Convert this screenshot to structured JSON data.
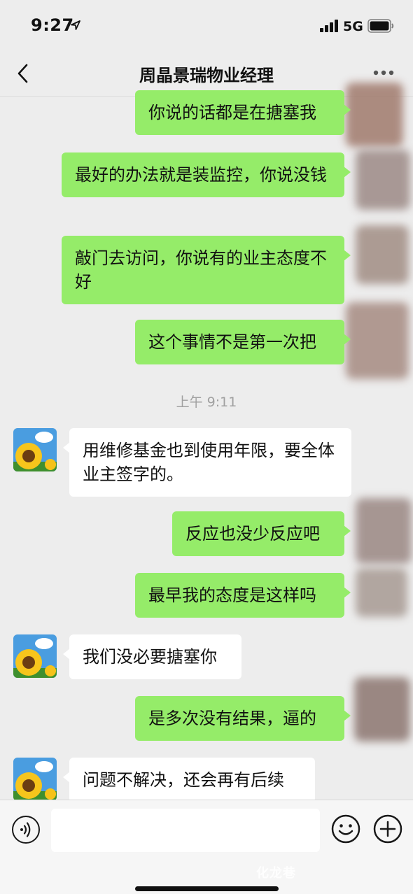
{
  "status_bar": {
    "time": "9:27",
    "network": "5G"
  },
  "header": {
    "title": "周晶景瑞物业经理"
  },
  "messages": [
    {
      "sender": "me",
      "text": "你说的话都是在搪塞我"
    },
    {
      "sender": "me",
      "text": "最好的办法就是装监控，你说没钱"
    },
    {
      "sender": "me",
      "text": "敲门去访问，你说有的业主态度不好"
    },
    {
      "sender": "me",
      "text": "这个事情不是第一次把"
    },
    {
      "sender": "them",
      "text": "用维修基金也到使用年限，要全体业主签字的。"
    },
    {
      "sender": "me",
      "text": "反应也没少反应吧"
    },
    {
      "sender": "me",
      "text": "最早我的态度是这样吗"
    },
    {
      "sender": "them",
      "text": "我们没必要搪塞你"
    },
    {
      "sender": "me",
      "text": "是多次没有结果，逼的"
    },
    {
      "sender": "them",
      "text": "问题不解决，还会再有后续"
    }
  ],
  "timestamp": "上午 9:11",
  "input_bar": {
    "message_value": ""
  },
  "watermark": "化龙巷",
  "icons": {
    "back": "chevron-left-icon",
    "more": "more-dots-icon",
    "voice": "voice-icon",
    "emoji": "emoji-icon",
    "add": "plus-circle-icon"
  },
  "colors": {
    "background": "#ededed",
    "my_bubble": "#95ec69",
    "their_bubble": "#ffffff"
  }
}
